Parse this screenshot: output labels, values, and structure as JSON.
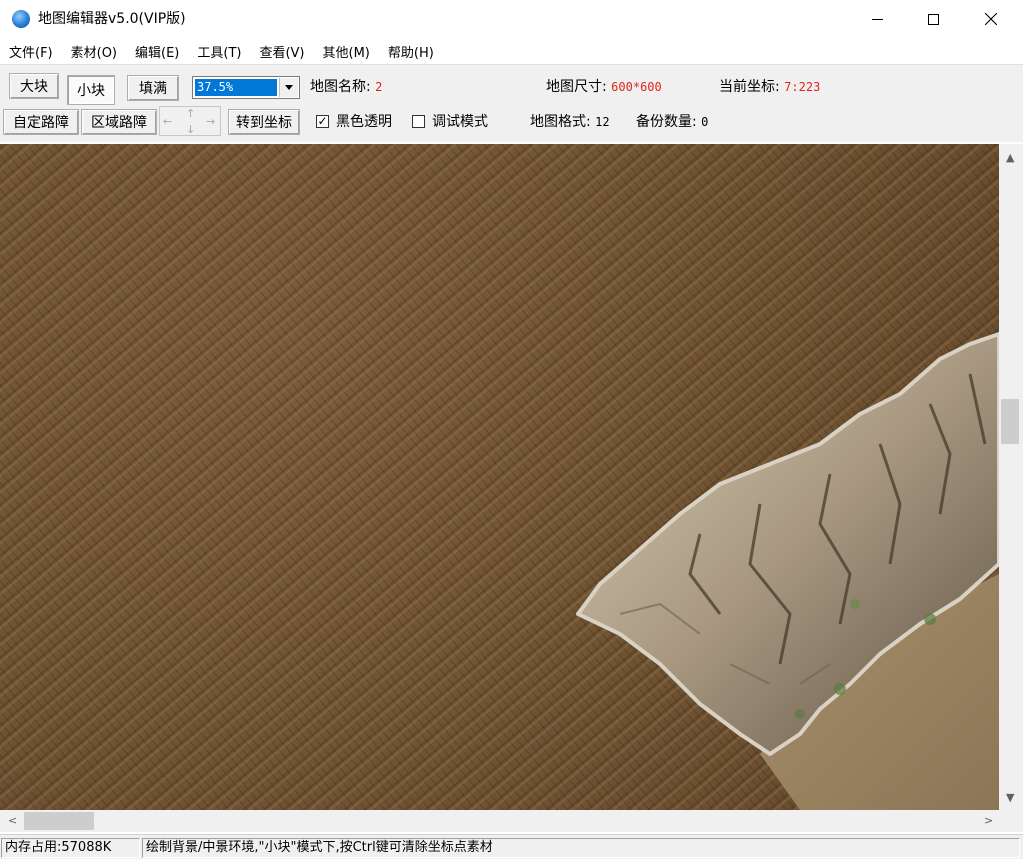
{
  "window": {
    "title": "地图编辑器v5.0(VIP版)",
    "app_icon": "globe-icon",
    "controls": {
      "minimize": "minimize-icon",
      "maximize": "maximize-icon",
      "close": "close-icon"
    }
  },
  "menu": [
    "文件(F)",
    "素材(O)",
    "编辑(E)",
    "工具(T)",
    "查看(V)",
    "其他(M)",
    "帮助(H)"
  ],
  "toolbar": {
    "big_block": "大块",
    "small_block": "小块",
    "fill": "填满",
    "zoom_value": "37.5%",
    "custom_obstacle": "自定路障",
    "area_obstacle": "区域路障",
    "goto_coord": "转到坐标",
    "black_transparent": {
      "label": "黑色透明",
      "checked": true,
      "mark": "✓"
    },
    "debug_mode": {
      "label": "调试模式",
      "checked": false
    },
    "map_name_label": "地图名称:",
    "map_name_value": "2",
    "map_size_label": "地图尺寸:",
    "map_size_value": "600*600",
    "current_coord_label": "当前坐标:",
    "current_coord_value": "7:223",
    "map_format_label": "地图格式:",
    "map_format_value": "12",
    "backup_count_label": "备份数量:",
    "backup_count_value": "0",
    "direction_pad": {
      "left": "←",
      "up": "↑",
      "down": "↓",
      "right": "→"
    },
    "accent_color": "#0078d7",
    "value_color": "#e0251c"
  },
  "scroll": {
    "up": "▲",
    "down": "▼",
    "left": "<",
    "right": ">"
  },
  "status": {
    "memory": "内存占用:57088K",
    "hint": "绘制背景/中景环境,\"小块\"模式下,按Ctrl键可清除坐标点素材"
  }
}
